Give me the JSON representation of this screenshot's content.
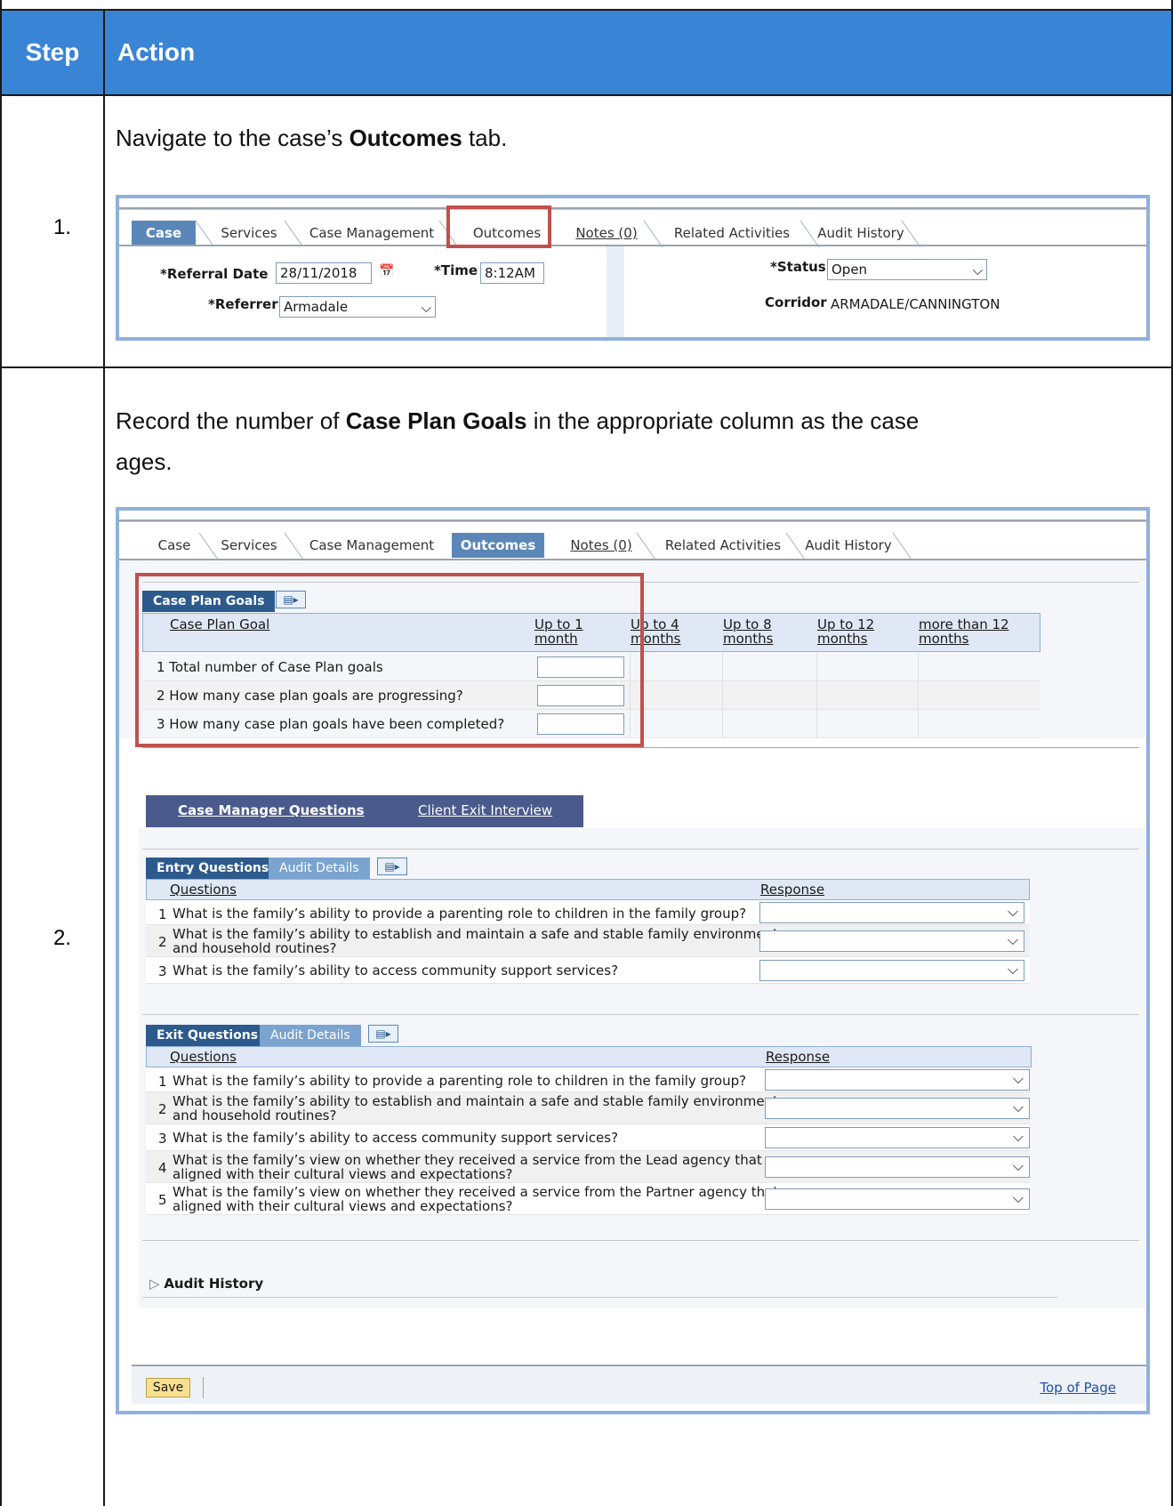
{
  "header": {
    "step": "Step",
    "action": "Action"
  },
  "steps": [
    {
      "number": "1.",
      "instruction_prefix": "Navigate to the case’s ",
      "instruction_bold": "Outcomes",
      "instruction_suffix": " tab."
    },
    {
      "number": "2.",
      "instruction_prefix": "Record the number of ",
      "instruction_bold": "Case Plan Goals",
      "instruction_suffix": " in the appropriate column as the case",
      "instruction_line2": "ages."
    }
  ],
  "tabs": [
    "Case",
    "Services",
    "Case Management",
    "Outcomes",
    "Notes (0)",
    "Related Activities",
    "Audit History"
  ],
  "shot1": {
    "referral_date_label": "*Referral Date",
    "referral_date_value": "28/11/2018",
    "time_label": "*Time",
    "time_value": "8:12AM",
    "status_label": "*Status",
    "status_value": "Open",
    "referrer_label": "*Referrer",
    "referrer_value": "Armadale",
    "corridor_label": "Corridor",
    "corridor_value": "ARMADALE/CANNINGTON"
  },
  "case_plan": {
    "tab_label": "Case Plan Goals",
    "columns": [
      "Case Plan Goal",
      "Up to 1 month",
      "Up to 4 months",
      "Up to 8 months",
      "Up to 12 months",
      "more than 12 months"
    ],
    "rows": [
      "1 Total number of Case Plan goals",
      "2 How many case plan goals are progressing?",
      "3 How many case plan goals have been completed?"
    ]
  },
  "subtabs": {
    "active": "Case Manager Questions",
    "other": "Client Exit Interview"
  },
  "entry": {
    "tab_label": "Entry Questions",
    "audit_label": "Audit Details",
    "col_questions": "Questions",
    "col_response": "Response",
    "rows": [
      {
        "n": "1",
        "l1": "What is the family’s ability to provide a parenting role to children in the family group?",
        "l2": ""
      },
      {
        "n": "2",
        "l1": "What is the family’s ability to establish and maintain a safe and stable family environment",
        "l2": "and household routines?"
      },
      {
        "n": "3",
        "l1": "What is the family’s ability to access community support services?",
        "l2": ""
      }
    ]
  },
  "exit": {
    "tab_label": "Exit Questions",
    "audit_label": "Audit Details",
    "col_questions": "Questions",
    "col_response": "Response",
    "rows": [
      {
        "n": "1",
        "l1": "What is the family’s ability to provide a parenting role to children in the family group?",
        "l2": ""
      },
      {
        "n": "2",
        "l1": "What is the family’s ability to establish and maintain a safe and stable family environment",
        "l2": "and household routines?"
      },
      {
        "n": "3",
        "l1": "What is the family’s ability to access community support services?",
        "l2": ""
      },
      {
        "n": "4",
        "l1": "What is the family’s view on whether they received a service from the Lead agency that",
        "l2": "aligned with their cultural views and expectations?"
      },
      {
        "n": "5",
        "l1": "What is the family’s view on whether they received a service from the Partner agency that",
        "l2": "aligned with their cultural views and expectations?"
      }
    ]
  },
  "audit_history": "Audit History",
  "save": "Save",
  "top_of_page": "Top of Page"
}
